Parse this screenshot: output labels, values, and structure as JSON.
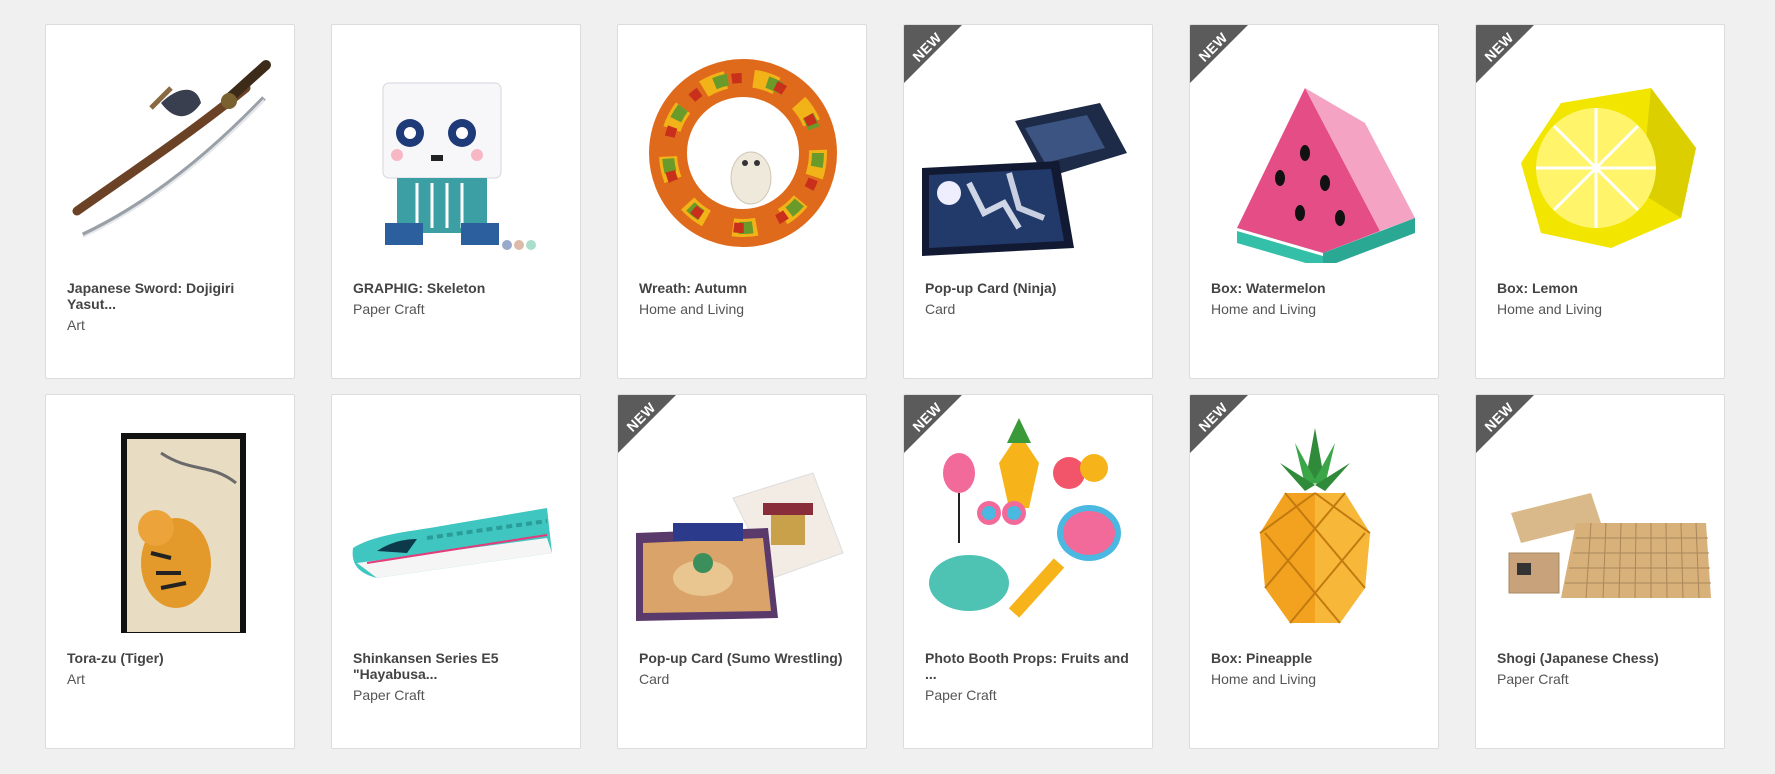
{
  "new_badge": "NEW",
  "products": [
    {
      "title": "Japanese Sword: Dojigiri Yasut...",
      "category": "Art",
      "is_new": false,
      "icon": "sword"
    },
    {
      "title": "GRAPHIG: Skeleton",
      "category": "Paper Craft",
      "is_new": false,
      "icon": "skeleton"
    },
    {
      "title": "Wreath: Autumn",
      "category": "Home and Living",
      "is_new": false,
      "icon": "wreath"
    },
    {
      "title": "Pop-up Card (Ninja)",
      "category": "Card",
      "is_new": true,
      "icon": "ninja-card"
    },
    {
      "title": "Box: Watermelon",
      "category": "Home and Living",
      "is_new": true,
      "icon": "watermelon"
    },
    {
      "title": "Box: Lemon",
      "category": "Home and Living",
      "is_new": true,
      "icon": "lemon"
    },
    {
      "title": "Tora-zu (Tiger)",
      "category": "Art",
      "is_new": false,
      "icon": "tiger"
    },
    {
      "title": "Shinkansen Series E5 \"Hayabusa...",
      "category": "Paper Craft",
      "is_new": false,
      "icon": "train"
    },
    {
      "title": "Pop-up Card (Sumo Wrestling)",
      "category": "Card",
      "is_new": true,
      "icon": "sumo-card"
    },
    {
      "title": "Photo Booth Props: Fruits and ...",
      "category": "Paper Craft",
      "is_new": true,
      "icon": "props"
    },
    {
      "title": "Box: Pineapple",
      "category": "Home and Living",
      "is_new": true,
      "icon": "pineapple"
    },
    {
      "title": "Shogi (Japanese Chess)",
      "category": "Paper Craft",
      "is_new": true,
      "icon": "shogi"
    }
  ]
}
